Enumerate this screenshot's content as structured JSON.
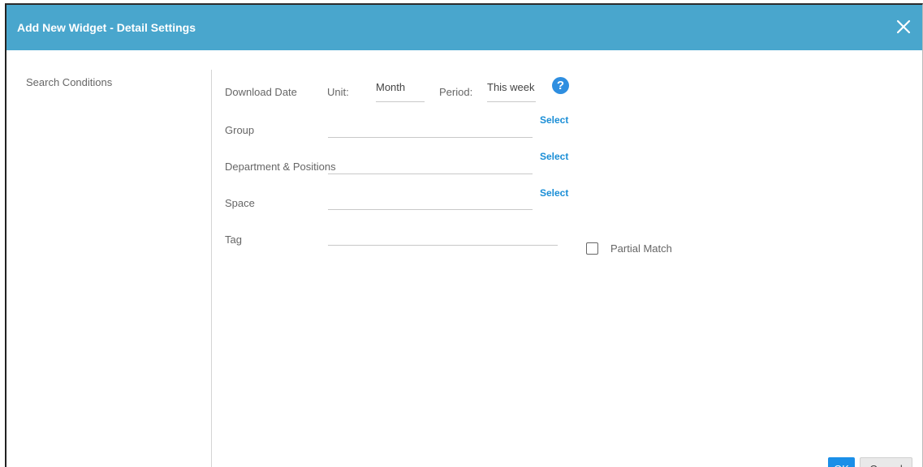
{
  "dialog": {
    "title": "Add New Widget - Detail Settings"
  },
  "sidebar": {
    "section_label": "Search Conditions"
  },
  "form": {
    "download_date": {
      "label": "Download Date",
      "unit_label": "Unit:",
      "unit_value": "Month",
      "period_label": "Period:",
      "period_value": "This week"
    },
    "group": {
      "label": "Group",
      "value": "",
      "action": "Select"
    },
    "department": {
      "label": "Department & Positions",
      "value": "",
      "action": "Select"
    },
    "space": {
      "label": "Space",
      "value": "",
      "action": "Select"
    },
    "tag": {
      "label": "Tag",
      "value": ""
    },
    "partial_match": {
      "label": "Partial Match",
      "checked": false
    }
  },
  "footer": {
    "ok_label": "OK",
    "cancel_label": "Cancel"
  },
  "colors": {
    "header": "#49a6cd",
    "primary_button": "#1b8fe8",
    "link": "#1a8ed6"
  }
}
